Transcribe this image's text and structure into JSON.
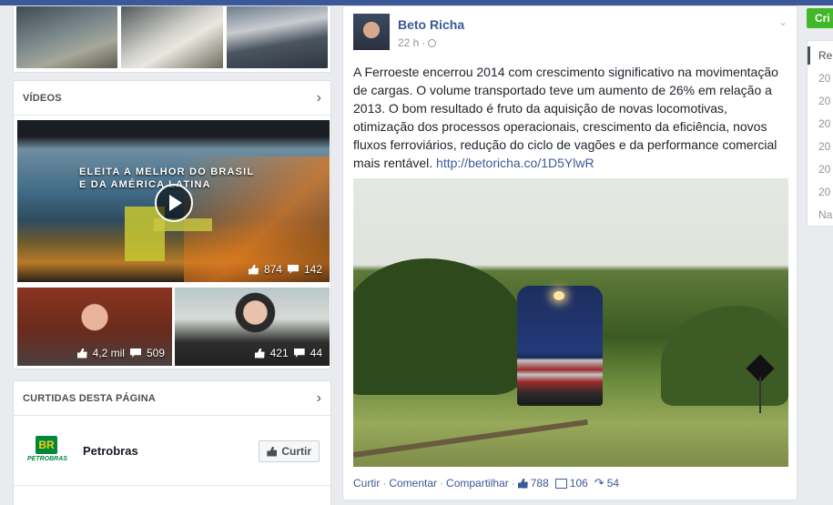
{
  "videos_section": {
    "title": "VÍDEOS",
    "main_video": {
      "caption_line1": "ELEITA A MELHOR DO BRASIL",
      "caption_line2": "E DA AMÉRICA LATINA",
      "likes": "874",
      "comments": "142"
    },
    "small_videos": [
      {
        "likes": "4,2 mil",
        "comments": "509"
      },
      {
        "likes": "421",
        "comments": "44"
      }
    ]
  },
  "liked_section": {
    "title": "CURTIDAS DESTA PÁGINA",
    "pages": [
      {
        "name": "Petrobras",
        "logo_box": "BR",
        "logo_text": "PETROBRAS",
        "button_label": "Curtir"
      }
    ]
  },
  "post": {
    "author": "Beto Richa",
    "time": "22 h",
    "text": "A Ferroeste encerrou 2014 com crescimento significativo na movimentação de cargas. O volume transportado teve um aumento de 26% em relação a 2013. O bom resultado é fruto da aquisição de novas locomotivas, otimização dos processos operacionais, crescimento da eficiência, novos fluxos ferroviários, redução do ciclo de vagões e da performance comercial mais rentável.",
    "link": "http://betoricha.co/1D5YlwR",
    "actions": {
      "like_label": "Curtir",
      "comment_label": "Comentar",
      "share_label": "Compartilhar",
      "likes": "788",
      "comments": "106",
      "shares": "54"
    }
  },
  "right_column": {
    "create_button": "Cri",
    "items": [
      "Re",
      "20",
      "20",
      "20",
      "20",
      "20",
      "20",
      "Na"
    ]
  },
  "colors": {
    "brand_blue": "#3b5998",
    "create_green": "#42b72a",
    "petrobras_green": "#00873e",
    "petrobras_yellow": "#f6d200"
  }
}
